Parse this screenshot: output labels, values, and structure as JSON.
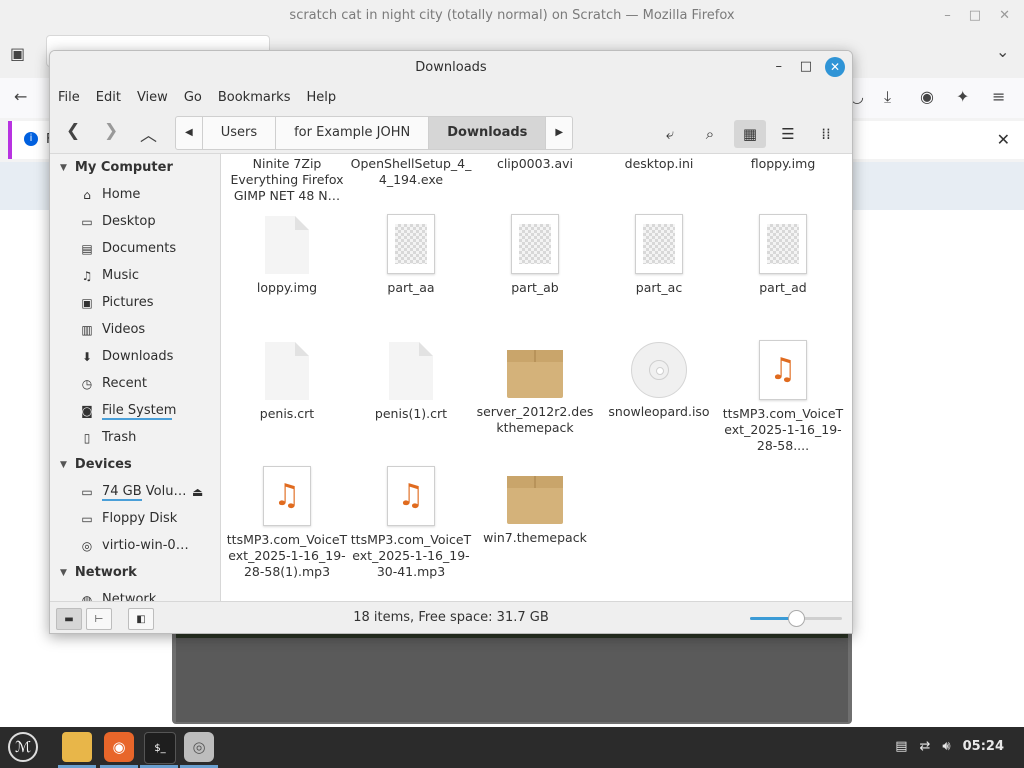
{
  "firefox": {
    "window_title": "scratch cat in night city (totally normal) on Scratch — Mozilla Firefox",
    "notification_prefix": "F"
  },
  "window": {
    "title": "Downloads",
    "minimize": "–",
    "maximize": "□",
    "close": "✕"
  },
  "menu": [
    "File",
    "Edit",
    "View",
    "Go",
    "Bookmarks",
    "Help"
  ],
  "breadcrumbs": [
    "Users",
    "for Example JOHN",
    "Downloads"
  ],
  "sidebar": {
    "my_computer": {
      "header": "My Computer",
      "items": [
        {
          "label": "Home",
          "icon": "home-icon"
        },
        {
          "label": "Desktop",
          "icon": "desktop-icon"
        },
        {
          "label": "Documents",
          "icon": "documents-icon"
        },
        {
          "label": "Music",
          "icon": "music-icon"
        },
        {
          "label": "Pictures",
          "icon": "pictures-icon"
        },
        {
          "label": "Videos",
          "icon": "videos-icon"
        },
        {
          "label": "Downloads",
          "icon": "downloads-icon"
        },
        {
          "label": "Recent",
          "icon": "recent-icon"
        },
        {
          "label": "File System",
          "icon": "filesystem-icon"
        },
        {
          "label": "Trash",
          "icon": "trash-icon"
        }
      ]
    },
    "devices": {
      "header": "Devices",
      "items": [
        {
          "label": "74 GB Volu…",
          "icon": "drive-icon"
        },
        {
          "label": "Floppy Disk",
          "icon": "floppy-icon"
        },
        {
          "label": "virtio-win-0…",
          "icon": "cdrom-icon"
        }
      ]
    },
    "network": {
      "header": "Network",
      "items": [
        {
          "label": "Network",
          "icon": "network-icon"
        }
      ]
    }
  },
  "files": [
    {
      "name": "Ninite 7Zip Everything Firefox GIMP NET 48 N…",
      "type": "partial"
    },
    {
      "name": "OpenShellSetup_4_4_194.exe",
      "type": "partial"
    },
    {
      "name": "clip0003.avi",
      "type": "partial"
    },
    {
      "name": "desktop.ini",
      "type": "partial"
    },
    {
      "name": "floppy.img",
      "type": "partial"
    },
    {
      "name": "loppy.img",
      "type": "blank"
    },
    {
      "name": "part_aa",
      "type": "checker"
    },
    {
      "name": "part_ab",
      "type": "checker"
    },
    {
      "name": "part_ac",
      "type": "checker"
    },
    {
      "name": "part_ad",
      "type": "checker"
    },
    {
      "name": "penis.crt",
      "type": "blank"
    },
    {
      "name": "penis(1).crt",
      "type": "blank"
    },
    {
      "name": "server_2012r2.deskthemepack",
      "type": "box"
    },
    {
      "name": "snowleopard.iso",
      "type": "disc"
    },
    {
      "name": "ttsMP3.com_VoiceText_2025-1-16_19-28-58....",
      "type": "music"
    },
    {
      "name": "ttsMP3.com_VoiceText_2025-1-16_19-28-58(1).mp3",
      "type": "music"
    },
    {
      "name": "ttsMP3.com_VoiceText_2025-1-16_19-30-41.mp3",
      "type": "music"
    },
    {
      "name": "win7.themepack",
      "type": "box"
    }
  ],
  "status": {
    "text": "18 items, Free space: 31.7 GB",
    "zoom_level": 0.5
  },
  "taskbar": {
    "clock": "05:24"
  },
  "colors": {
    "accent": "#2f94d6",
    "music_icon": "#e06b1f",
    "box_icon": "#d4b27a",
    "taskbar": "#2b2b2b"
  }
}
